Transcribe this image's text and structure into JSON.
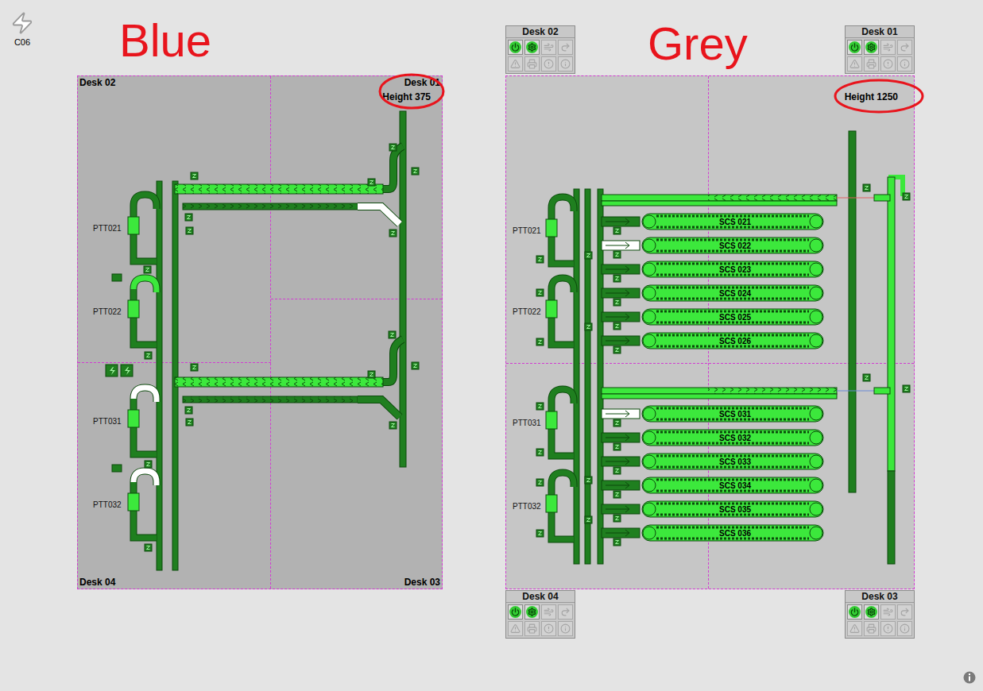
{
  "station": {
    "label": "C06"
  },
  "blue_view": {
    "annotation": "Blue",
    "height": "Height 375",
    "height_circled": true,
    "desk_labels": {
      "top_left": "Desk 02",
      "top_right": "Desk 01",
      "bottom_left": "Desk 04",
      "bottom_right": "Desk 03"
    },
    "ptts": [
      {
        "label": "PTT021",
        "loop_state": "stopped",
        "unit_state": "running"
      },
      {
        "label": "PTT022",
        "loop_state": "running",
        "unit_state": "running"
      },
      {
        "label": "PTT031",
        "loop_state": "idle",
        "unit_state": "running"
      },
      {
        "label": "PTT032",
        "loop_state": "idle",
        "unit_state": "running"
      }
    ],
    "infeeds": [
      {
        "track_state": "running",
        "return_state": "stopped",
        "return_end_state": "idle"
      },
      {
        "track_state": "running",
        "return_state": "stopped",
        "return_end_state": "stopped"
      }
    ]
  },
  "grey_view": {
    "annotation": "Grey",
    "height": "Height 1250",
    "height_circled": true,
    "desks": [
      {
        "title": "Desk 02",
        "buttons": [
          {
            "kind": "power",
            "enabled": true
          },
          {
            "kind": "settings",
            "enabled": true
          },
          {
            "kind": "sweep",
            "enabled": false
          },
          {
            "kind": "redo",
            "enabled": false
          },
          {
            "kind": "warning",
            "enabled": false
          },
          {
            "kind": "reader",
            "enabled": false
          },
          {
            "kind": "alarm",
            "enabled": false
          },
          {
            "kind": "info",
            "enabled": false
          }
        ]
      },
      {
        "title": "Desk 01",
        "buttons": [
          {
            "kind": "power",
            "enabled": true
          },
          {
            "kind": "settings",
            "enabled": true
          },
          {
            "kind": "sweep",
            "enabled": false
          },
          {
            "kind": "redo",
            "enabled": false
          },
          {
            "kind": "warning",
            "enabled": false
          },
          {
            "kind": "reader",
            "enabled": false
          },
          {
            "kind": "alarm",
            "enabled": false
          },
          {
            "kind": "info",
            "enabled": false
          }
        ]
      },
      {
        "title": "Desk 04",
        "buttons": [
          {
            "kind": "power",
            "enabled": true
          },
          {
            "kind": "settings",
            "enabled": true
          },
          {
            "kind": "sweep",
            "enabled": false
          },
          {
            "kind": "redo",
            "enabled": false
          },
          {
            "kind": "warning",
            "enabled": false
          },
          {
            "kind": "reader",
            "enabled": false
          },
          {
            "kind": "alarm",
            "enabled": false
          },
          {
            "kind": "info",
            "enabled": false
          }
        ]
      },
      {
        "title": "Desk 03",
        "buttons": [
          {
            "kind": "power",
            "enabled": true
          },
          {
            "kind": "settings",
            "enabled": true
          },
          {
            "kind": "sweep",
            "enabled": false
          },
          {
            "kind": "redo",
            "enabled": false
          },
          {
            "kind": "warning",
            "enabled": false
          },
          {
            "kind": "reader",
            "enabled": false
          },
          {
            "kind": "alarm",
            "enabled": false
          },
          {
            "kind": "info",
            "enabled": false
          }
        ]
      }
    ],
    "ptts": [
      {
        "label": "PTT021",
        "loop_state": "stopped",
        "unit_state": "running"
      },
      {
        "label": "PTT022",
        "loop_state": "stopped",
        "unit_state": "running"
      },
      {
        "label": "PTT031",
        "loop_state": "stopped",
        "unit_state": "running"
      },
      {
        "label": "PTT032",
        "loop_state": "stopped",
        "unit_state": "running"
      }
    ],
    "infeeds": [
      {
        "track_state": "running",
        "link_color": "#e06060"
      },
      {
        "track_state": "running",
        "link_color": "#6a8ad6"
      }
    ],
    "return_line": {
      "upper_state": "running",
      "lower_state": "stopped"
    },
    "scs": [
      {
        "label": "SCS 021",
        "state": "running",
        "feeder_state": "stopped"
      },
      {
        "label": "SCS 022",
        "state": "running",
        "feeder_state": "idle"
      },
      {
        "label": "SCS 023",
        "state": "running",
        "feeder_state": "stopped"
      },
      {
        "label": "SCS 024",
        "state": "running",
        "feeder_state": "stopped"
      },
      {
        "label": "SCS 025",
        "state": "running",
        "feeder_state": "stopped"
      },
      {
        "label": "SCS 026",
        "state": "running",
        "feeder_state": "stopped"
      },
      {
        "label": "SCS 031",
        "state": "running",
        "feeder_state": "idle"
      },
      {
        "label": "SCS 032",
        "state": "running",
        "feeder_state": "stopped"
      },
      {
        "label": "SCS 033",
        "state": "running",
        "feeder_state": "stopped"
      },
      {
        "label": "SCS 034",
        "state": "running",
        "feeder_state": "stopped"
      },
      {
        "label": "SCS 035",
        "state": "running",
        "feeder_state": "stopped"
      },
      {
        "label": "SCS 036",
        "state": "running",
        "feeder_state": "stopped"
      }
    ]
  }
}
